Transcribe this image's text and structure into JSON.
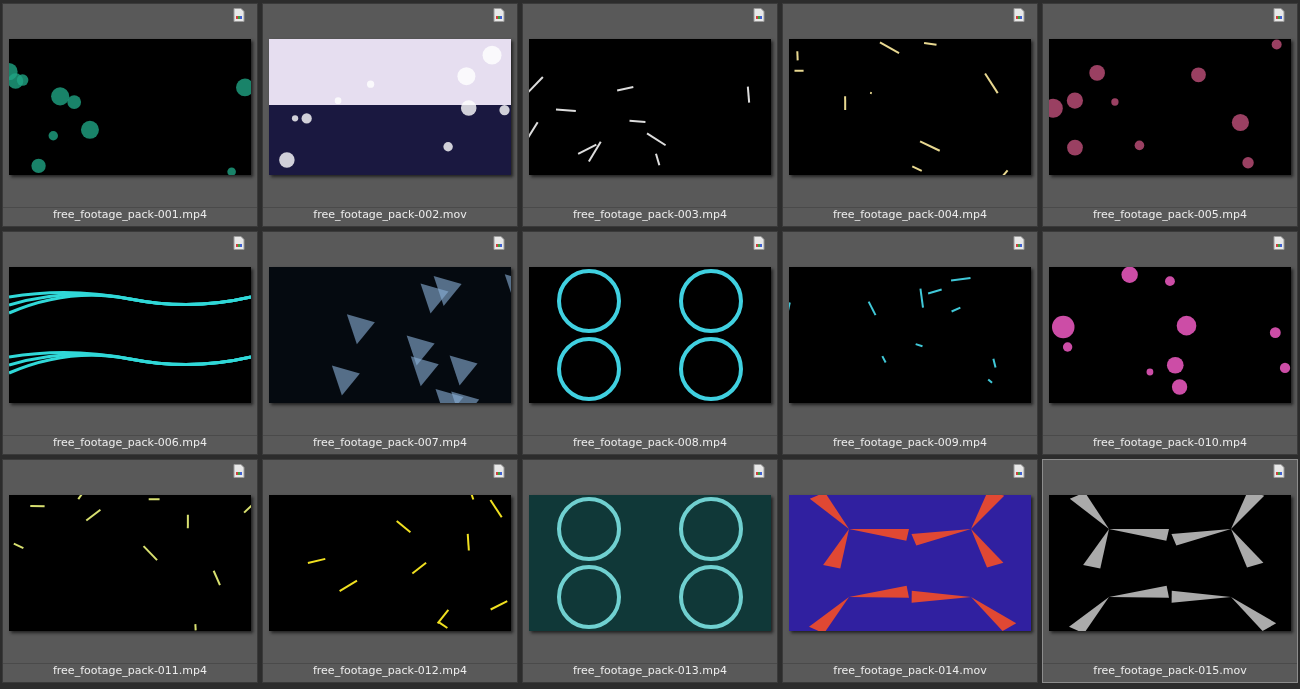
{
  "files": [
    {
      "name": "free_footage_pack-001.mp4",
      "selected": false
    },
    {
      "name": "free_footage_pack-002.mov",
      "selected": false
    },
    {
      "name": "free_footage_pack-003.mp4",
      "selected": false
    },
    {
      "name": "free_footage_pack-004.mp4",
      "selected": false
    },
    {
      "name": "free_footage_pack-005.mp4",
      "selected": false
    },
    {
      "name": "free_footage_pack-006.mp4",
      "selected": false
    },
    {
      "name": "free_footage_pack-007.mp4",
      "selected": false
    },
    {
      "name": "free_footage_pack-008.mp4",
      "selected": false
    },
    {
      "name": "free_footage_pack-009.mp4",
      "selected": false
    },
    {
      "name": "free_footage_pack-010.mp4",
      "selected": false
    },
    {
      "name": "free_footage_pack-011.mp4",
      "selected": false
    },
    {
      "name": "free_footage_pack-012.mp4",
      "selected": false
    },
    {
      "name": "free_footage_pack-013.mp4",
      "selected": false
    },
    {
      "name": "free_footage_pack-014.mov",
      "selected": false
    },
    {
      "name": "free_footage_pack-015.mov",
      "selected": true
    }
  ]
}
